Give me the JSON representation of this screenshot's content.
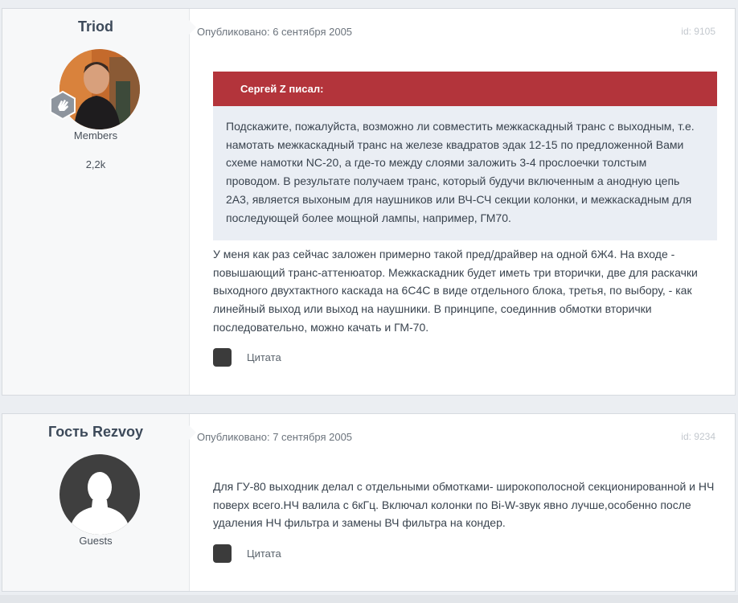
{
  "posts": [
    {
      "author": "Triod",
      "role": "Members",
      "post_count": "2,2k",
      "published": "Опубликовано: 6 сентября 2005",
      "post_id": "id: 9105",
      "quote": {
        "header": "Сергей Z писал:",
        "text": "Подскажите, пожалуйста, возможно ли совместить межкаскадный транс с выходным, т.е. намотать межкаскадный транс на железе квадратов эдак 12-15 по предложенной Вами схеме намотки NC-20, а где-то между слоями заложить 3-4 прослоечки толстым проводом. В результате получаем транс, который будучи включенным а анодную цепь 2А3, является выхоным для наушников или ВЧ-СЧ секции колонки, и межкаскадным для последующей более мощной лампы, например, ГМ70."
      },
      "text": "У меня как раз сейчас заложен примерно такой пред/драйвер на одной 6Ж4. На входе - повышающий транс-аттенюатор. Межкаскадник будет иметь три вторички, две для раскачки выходного двухтактного каскада на 6С4С в виде отдельного блока, третья, по выбору, - как линейный выход или выход на наушники. В принципе, соединнив обмотки вторички последовательно, можно качать и ГМ-70.",
      "quote_button": "Цитата"
    },
    {
      "author": "Гость Rezvoy",
      "role": "Guests",
      "published": "Опубликовано: 7 сентября 2005",
      "post_id": "id: 9234",
      "text": "Для ГУ-80 выходник делал с отдельными обмотками- широкополосной секционированной и НЧ поверх всего.НЧ валила с 6кГц. Включал колонки по Bi-W-звук явно лучше,особенно после удаления НЧ фильтра и замены ВЧ фильтра на кондер.",
      "quote_button": "Цитата"
    }
  ],
  "colors": {
    "quote_header_bg": "#b3343b",
    "quote_body_bg": "#eaeef4",
    "page_bg": "#ebeef2"
  },
  "icons": {
    "rank_badge": "hand-badge-icon",
    "quote": "quote-icon",
    "avatar_guest": "guest-silhouette-icon"
  }
}
